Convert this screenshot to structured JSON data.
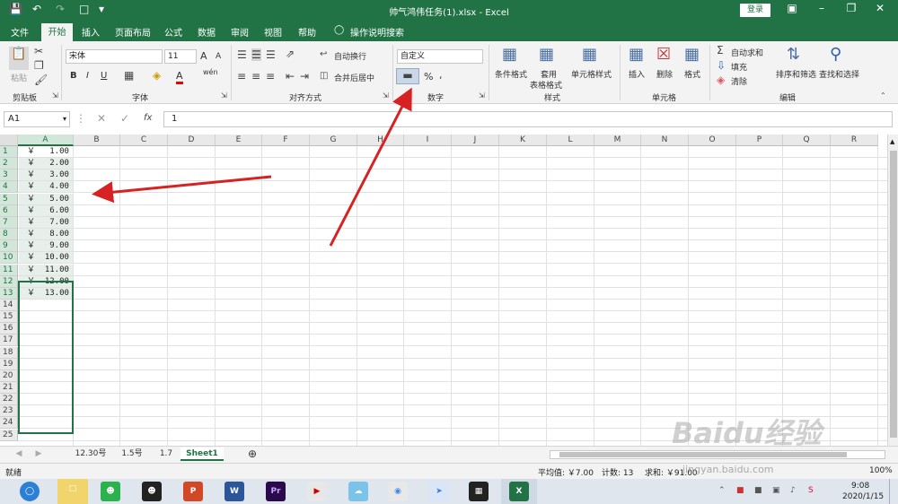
{
  "window": {
    "title": "帅气鸿伟任务(1).xlsx - Excel",
    "login": "登录"
  },
  "tabs": [
    "文件",
    "开始",
    "插入",
    "页面布局",
    "公式",
    "数据",
    "审阅",
    "视图",
    "帮助",
    "操作说明搜索"
  ],
  "share": "共享",
  "ribbon": {
    "clipboard": {
      "paste": "粘贴",
      "group": "剪贴板"
    },
    "font": {
      "name": "宋体",
      "size": "11",
      "bold": "B",
      "italic": "I",
      "underline": "U",
      "group": "字体",
      "grow": "A",
      "shrink": "A",
      "wen": "wén",
      "color_a": "A"
    },
    "align": {
      "wrap": "自动换行",
      "merge": "合并后居中",
      "group": "对齐方式"
    },
    "number": {
      "format": "自定义",
      "percent": "%",
      "comma": ",",
      "group": "数字"
    },
    "styles": {
      "cond": "条件格式",
      "table1": "套用",
      "table2": "表格格式",
      "cell": "单元格样式",
      "group": "样式"
    },
    "cells": {
      "insert": "插入",
      "delete": "删除",
      "format": "格式",
      "group": "单元格"
    },
    "edit": {
      "sum": "自动求和",
      "fill": "填充",
      "clear": "清除",
      "sort": "排序和筛选",
      "find": "查找和选择",
      "group": "编辑"
    }
  },
  "formula_bar": {
    "name_box": "A1",
    "fx": "fx",
    "value": "1"
  },
  "columns": [
    "A",
    "B",
    "C",
    "D",
    "E",
    "F",
    "G",
    "H",
    "I",
    "J",
    "K",
    "L",
    "M",
    "N",
    "O",
    "P",
    "Q",
    "R"
  ],
  "rows": [
    "1",
    "2",
    "3",
    "4",
    "5",
    "6",
    "7",
    "8",
    "9",
    "10",
    "11",
    "12",
    "13",
    "14",
    "15",
    "16",
    "17",
    "18",
    "19",
    "20",
    "21",
    "22",
    "23",
    "24",
    "25"
  ],
  "cells_a": [
    "￥   1.00",
    "￥   2.00",
    "￥   3.00",
    "￥   4.00",
    "￥   5.00",
    "￥   6.00",
    "￥   7.00",
    "￥   8.00",
    "￥   9.00",
    "￥  10.00",
    "￥  11.00",
    "￥  12.00",
    "￥  13.00"
  ],
  "sheets": [
    "12.30号",
    "1.5号",
    "1.7",
    "Sheet1"
  ],
  "status": {
    "ready": "就绪",
    "avg": "平均值: ￥7.00",
    "count": "计数: 13",
    "sum": "求和: ￥91.00",
    "zoom": "100%"
  },
  "watermark": "Baidu经验",
  "watermark_url": "jingyan.baidu.com",
  "taskbar": {
    "time": "9:08",
    "date": "2020/1/15"
  },
  "colors": {
    "accent": "#217346",
    "arrow": "#d62222"
  }
}
